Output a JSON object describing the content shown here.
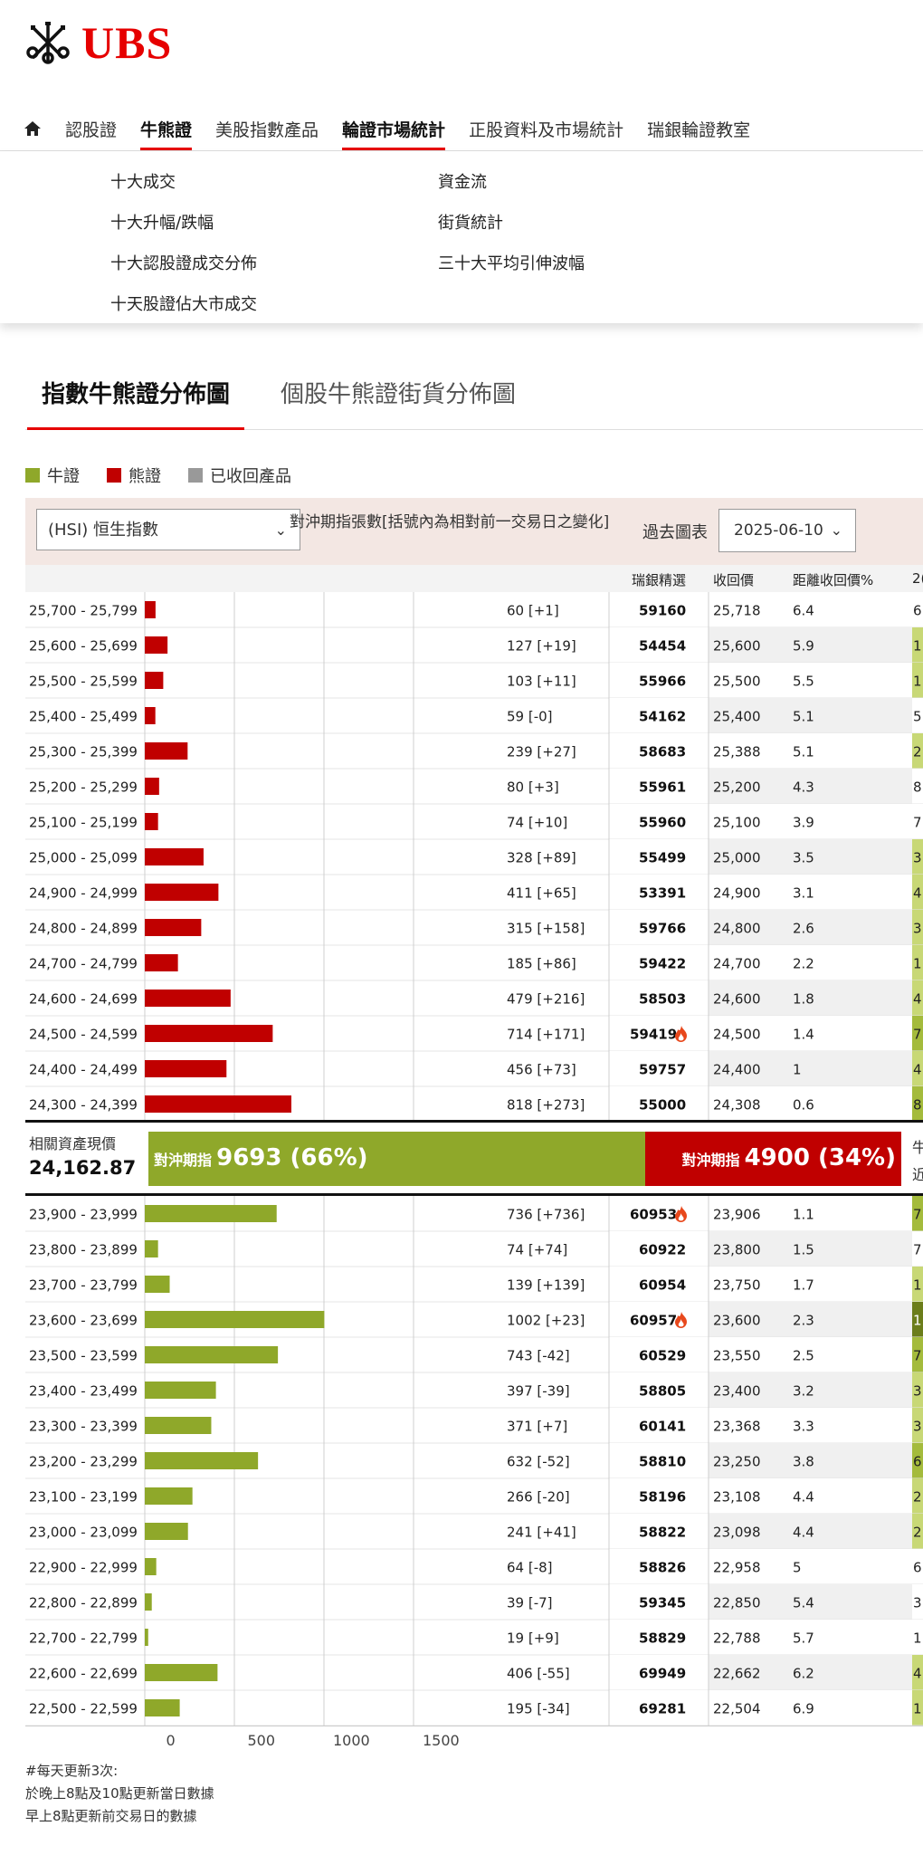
{
  "brand": {
    "name": "UBS",
    "color": "#e60000"
  },
  "nav": {
    "home_icon": "home-icon",
    "items": [
      {
        "label": "認股證",
        "active": false
      },
      {
        "label": "牛熊證",
        "active": true
      },
      {
        "label": "美股指數產品",
        "active": false
      },
      {
        "label": "輪證市場統計",
        "active": true
      },
      {
        "label": "正股資料及市場統計",
        "active": false
      },
      {
        "label": "瑞銀輪證教室",
        "active": false
      }
    ]
  },
  "submenu": {
    "col1": [
      "十大成交",
      "十大升幅/跌幅",
      "十大認股證成交分佈",
      "十天股證佔大市成交"
    ],
    "col2": [
      "資金流",
      "街貨統計",
      "三十大平均引伸波幅"
    ]
  },
  "tabs": [
    "指數牛熊證分佈圖",
    "個股牛熊證街貨分佈圖"
  ],
  "legend": [
    {
      "label": "牛證",
      "color": "#8fa82a"
    },
    {
      "label": "熊證",
      "color": "#c00000"
    },
    {
      "label": "已收回產品",
      "color": "#999999"
    }
  ],
  "filter": {
    "index_select": "(HSI) 恒生指數",
    "hedge_note": "對沖期指張數[括號內為相對前一交易日之變化]",
    "past_chart_label": "過去圖表",
    "date_value": "2025-06-10"
  },
  "columns": {
    "ubs_pick": "瑞銀精選",
    "call_price": "收回價",
    "distance": "距離收回價%",
    "cut": "2("
  },
  "summary": {
    "label": "相關資產現價",
    "value": "24,162.87",
    "bull_label": "對沖期指",
    "bull_value": "9693 (66%)",
    "bear_label": "對沖期指",
    "bear_value": "4900 (34%)",
    "right_cut": "牛",
    "right_cut2": "近",
    "bull_share": 0.66,
    "bear_share": 0.34
  },
  "chart_data": {
    "type": "bar",
    "orientation": "horizontal",
    "xlim": [
      0,
      1500
    ],
    "xticks": [
      "0",
      "500",
      "1000",
      "1500"
    ],
    "grid": true,
    "bear_rows": [
      {
        "range": "25,700 - 25,799",
        "value": 60,
        "label": "60 [+1]",
        "code": "59160",
        "hot": false,
        "call": "25,718",
        "dist": "6.4",
        "cut": "6",
        "cut_color": "#ffffff"
      },
      {
        "range": "25,600 - 25,699",
        "value": 127,
        "label": "127 [+19]",
        "code": "54454",
        "hot": false,
        "call": "25,600",
        "dist": "5.9",
        "cut": "1",
        "cut_color": "#c8d876"
      },
      {
        "range": "25,500 - 25,599",
        "value": 103,
        "label": "103 [+11]",
        "code": "55966",
        "hot": false,
        "call": "25,500",
        "dist": "5.5",
        "cut": "1",
        "cut_color": "#c8d876"
      },
      {
        "range": "25,400 - 25,499",
        "value": 59,
        "label": "59 [-0]",
        "code": "54162",
        "hot": false,
        "call": "25,400",
        "dist": "5.1",
        "cut": "5",
        "cut_color": "#ffffff"
      },
      {
        "range": "25,300 - 25,399",
        "value": 239,
        "label": "239 [+27]",
        "code": "58683",
        "hot": false,
        "call": "25,388",
        "dist": "5.1",
        "cut": "2",
        "cut_color": "#c8d876"
      },
      {
        "range": "25,200 - 25,299",
        "value": 80,
        "label": "80 [+3]",
        "code": "55961",
        "hot": false,
        "call": "25,200",
        "dist": "4.3",
        "cut": "8",
        "cut_color": "#ffffff"
      },
      {
        "range": "25,100 - 25,199",
        "value": 74,
        "label": "74 [+10]",
        "code": "55960",
        "hot": false,
        "call": "25,100",
        "dist": "3.9",
        "cut": "7",
        "cut_color": "#ffffff"
      },
      {
        "range": "25,000 - 25,099",
        "value": 328,
        "label": "328 [+89]",
        "code": "55499",
        "hot": false,
        "call": "25,000",
        "dist": "3.5",
        "cut": "3",
        "cut_color": "#c8d876"
      },
      {
        "range": "24,900 - 24,999",
        "value": 411,
        "label": "411 [+65]",
        "code": "53391",
        "hot": false,
        "call": "24,900",
        "dist": "3.1",
        "cut": "4",
        "cut_color": "#c8d876"
      },
      {
        "range": "24,800 - 24,899",
        "value": 315,
        "label": "315 [+158]",
        "code": "59766",
        "hot": false,
        "call": "24,800",
        "dist": "2.6",
        "cut": "3",
        "cut_color": "#c8d876"
      },
      {
        "range": "24,700 - 24,799",
        "value": 185,
        "label": "185 [+86]",
        "code": "59422",
        "hot": false,
        "call": "24,700",
        "dist": "2.2",
        "cut": "1",
        "cut_color": "#c8d876"
      },
      {
        "range": "24,600 - 24,699",
        "value": 479,
        "label": "479 [+216]",
        "code": "58503",
        "hot": false,
        "call": "24,600",
        "dist": "1.8",
        "cut": "4",
        "cut_color": "#c8d876"
      },
      {
        "range": "24,500 - 24,599",
        "value": 714,
        "label": "714 [+171]",
        "code": "59419",
        "hot": true,
        "call": "24,500",
        "dist": "1.4",
        "cut": "7",
        "cut_color": "#a4bb3c"
      },
      {
        "range": "24,400 - 24,499",
        "value": 456,
        "label": "456 [+73]",
        "code": "59757",
        "hot": false,
        "call": "24,400",
        "dist": "1",
        "cut": "4",
        "cut_color": "#c8d876"
      },
      {
        "range": "24,300 - 24,399",
        "value": 818,
        "label": "818 [+273]",
        "code": "55000",
        "hot": false,
        "call": "24,308",
        "dist": "0.6",
        "cut": "8",
        "cut_color": "#a4bb3c"
      }
    ],
    "bull_rows": [
      {
        "range": "23,900 - 23,999",
        "value": 736,
        "label": "736 [+736]",
        "code": "60953",
        "hot": true,
        "call": "23,906",
        "dist": "1.1",
        "cut": "7",
        "cut_color": "#a4bb3c"
      },
      {
        "range": "23,800 - 23,899",
        "value": 74,
        "label": "74 [+74]",
        "code": "60922",
        "hot": false,
        "call": "23,800",
        "dist": "1.5",
        "cut": "7",
        "cut_color": "#ffffff"
      },
      {
        "range": "23,700 - 23,799",
        "value": 139,
        "label": "139 [+139]",
        "code": "60954",
        "hot": false,
        "call": "23,750",
        "dist": "1.7",
        "cut": "1",
        "cut_color": "#c8d876"
      },
      {
        "range": "23,600 - 23,699",
        "value": 1002,
        "label": "1002 [+23]",
        "code": "60957",
        "hot": true,
        "call": "23,600",
        "dist": "2.3",
        "cut": "1",
        "cut_color": "#6b7d1a"
      },
      {
        "range": "23,500 - 23,599",
        "value": 743,
        "label": "743 [-42]",
        "code": "60529",
        "hot": false,
        "call": "23,550",
        "dist": "2.5",
        "cut": "7",
        "cut_color": "#a4bb3c"
      },
      {
        "range": "23,400 - 23,499",
        "value": 397,
        "label": "397 [-39]",
        "code": "58805",
        "hot": false,
        "call": "23,400",
        "dist": "3.2",
        "cut": "3",
        "cut_color": "#c8d876"
      },
      {
        "range": "23,300 - 23,399",
        "value": 371,
        "label": "371 [+7]",
        "code": "60141",
        "hot": false,
        "call": "23,368",
        "dist": "3.3",
        "cut": "3",
        "cut_color": "#c8d876"
      },
      {
        "range": "23,200 - 23,299",
        "value": 632,
        "label": "632 [-52]",
        "code": "58810",
        "hot": false,
        "call": "23,250",
        "dist": "3.8",
        "cut": "6",
        "cut_color": "#a4bb3c"
      },
      {
        "range": "23,100 - 23,199",
        "value": 266,
        "label": "266 [-20]",
        "code": "58196",
        "hot": false,
        "call": "23,108",
        "dist": "4.4",
        "cut": "2",
        "cut_color": "#c8d876"
      },
      {
        "range": "23,000 - 23,099",
        "value": 241,
        "label": "241 [+41]",
        "code": "58822",
        "hot": false,
        "call": "23,098",
        "dist": "4.4",
        "cut": "2",
        "cut_color": "#c8d876"
      },
      {
        "range": "22,900 - 22,999",
        "value": 64,
        "label": "64 [-8]",
        "code": "58826",
        "hot": false,
        "call": "22,958",
        "dist": "5",
        "cut": "6",
        "cut_color": "#ffffff"
      },
      {
        "range": "22,800 - 22,899",
        "value": 39,
        "label": "39 [-7]",
        "code": "59345",
        "hot": false,
        "call": "22,850",
        "dist": "5.4",
        "cut": "3",
        "cut_color": "#ffffff"
      },
      {
        "range": "22,700 - 22,799",
        "value": 19,
        "label": "19 [+9]",
        "code": "58829",
        "hot": false,
        "call": "22,788",
        "dist": "5.7",
        "cut": "1",
        "cut_color": "#ffffff"
      },
      {
        "range": "22,600 - 22,699",
        "value": 406,
        "label": "406 [-55]",
        "code": "69949",
        "hot": false,
        "call": "22,662",
        "dist": "6.2",
        "cut": "4",
        "cut_color": "#c8d876"
      },
      {
        "range": "22,500 - 22,599",
        "value": 195,
        "label": "195 [-34]",
        "code": "69281",
        "hot": false,
        "call": "22,504",
        "dist": "6.9",
        "cut": "1",
        "cut_color": "#c8d876"
      }
    ],
    "colors": {
      "bull": "#8fa82a",
      "bear": "#c00000"
    }
  },
  "footnote": [
    "#每天更新3次:",
    "於晚上8點及10點更新當日數據",
    "早上8點更新前交易日的數據"
  ]
}
